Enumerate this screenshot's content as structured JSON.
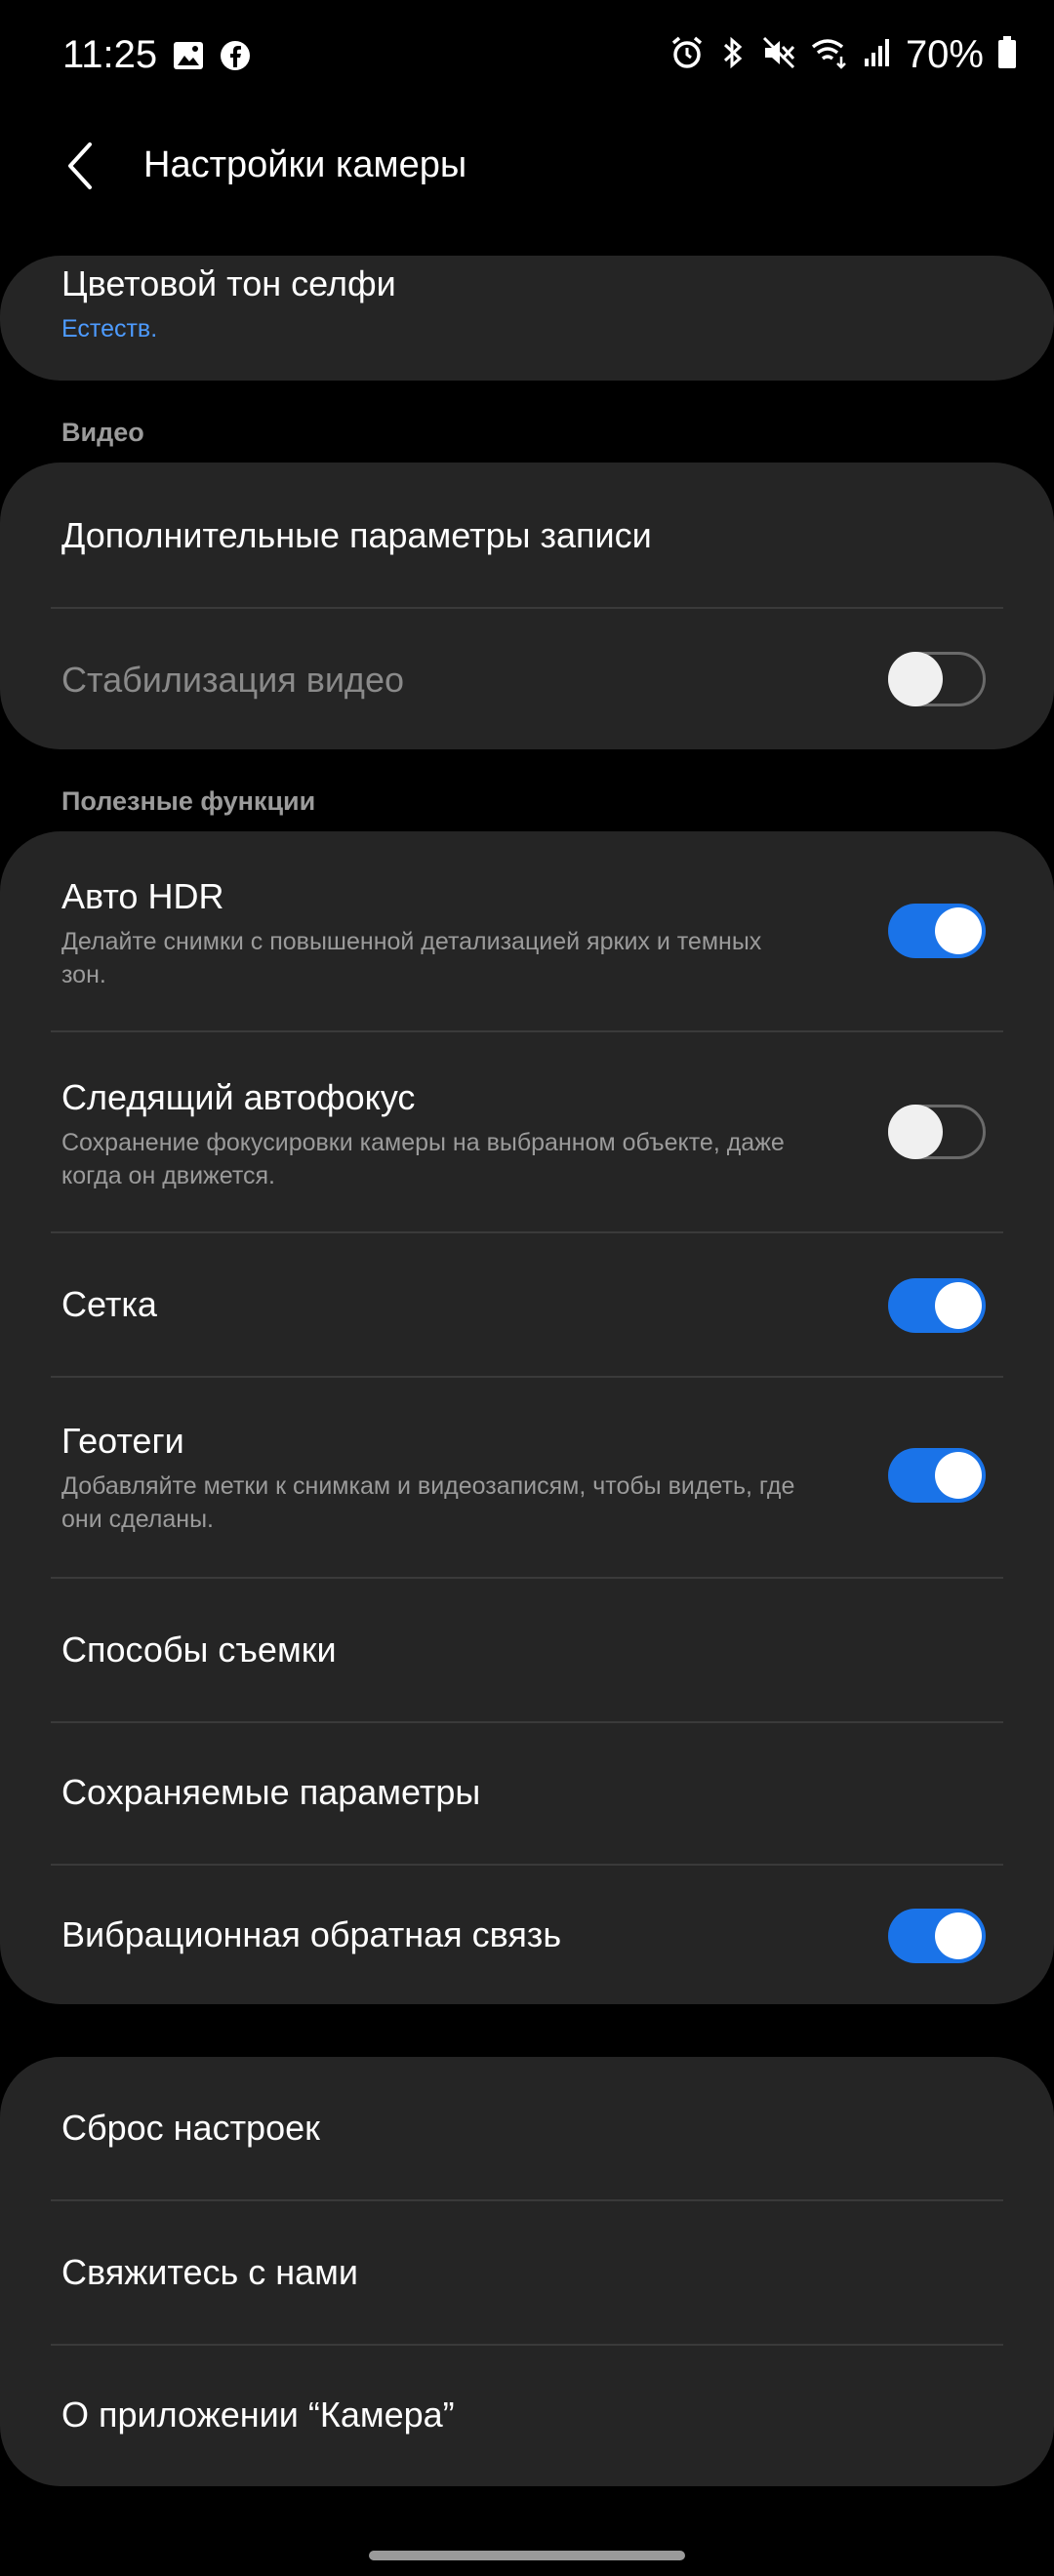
{
  "status_bar": {
    "time": "11:25",
    "battery": "70%",
    "icons": [
      "gallery-icon",
      "facebook-icon",
      "alarm-icon",
      "bluetooth-icon",
      "mute-icon",
      "wifi-icon",
      "signal-icon",
      "battery-icon"
    ]
  },
  "header": {
    "title": "Настройки камеры"
  },
  "top_card": {
    "title": "Цветовой тон селфи",
    "value": "Естеств."
  },
  "video": {
    "section": "Видео",
    "advanced": "Дополнительные параметры записи",
    "stabilization": "Стабилизация видео",
    "stabilization_on": false
  },
  "useful": {
    "section": "Полезные функции",
    "auto_hdr": {
      "title": "Авто HDR",
      "desc": "Делайте снимки с повышенной детализацией ярких и темных зон.",
      "on": true
    },
    "tracking_af": {
      "title": "Следящий автофокус",
      "desc": "Сохранение фокусировки камеры на выбранном объекте, даже когда он движется.",
      "on": false
    },
    "grid": {
      "title": "Сетка",
      "on": true
    },
    "geotags": {
      "title": "Геотеги",
      "desc": "Добавляйте метки к снимкам и видеозаписям, чтобы видеть, где они сделаны.",
      "on": true
    },
    "shooting_methods": "Способы съемки",
    "saved_settings": "Сохраняемые параметры",
    "vibration": {
      "title": "Вибрационная обратная связь",
      "on": true
    }
  },
  "bottom": {
    "reset": "Сброс настроек",
    "contact": "Свяжитесь с нами",
    "about": "О приложении “Камера”"
  },
  "colors": {
    "accent": "#1a73e8",
    "link": "#4d9bff",
    "card": "#252525"
  }
}
